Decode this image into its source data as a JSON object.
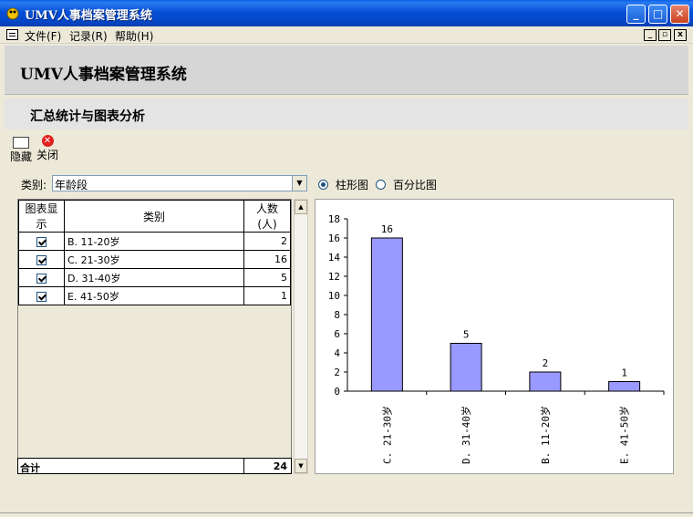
{
  "window": {
    "title": "UMV人事档案管理系统"
  },
  "menu": {
    "items": [
      "文件(F)",
      "记录(R)",
      "帮助(H)"
    ]
  },
  "header": {
    "app_title": "UMV人事档案管理系统",
    "section_title": "汇总统计与图表分析"
  },
  "toolbar": {
    "hide_label": "隐藏",
    "close_label": "关闭"
  },
  "filter": {
    "label": "类别:",
    "value": "年龄段"
  },
  "chart_mode": {
    "bar_label": "柱形图",
    "percent_label": "百分比图",
    "selected": "柱形图"
  },
  "table": {
    "columns": [
      "图表显示",
      "类别",
      "人数(人)"
    ],
    "rows": [
      {
        "checked": true,
        "category": "B. 11-20岁",
        "count": "2"
      },
      {
        "checked": true,
        "category": "C. 21-30岁",
        "count": "16"
      },
      {
        "checked": true,
        "category": "D. 31-40岁",
        "count": "5"
      },
      {
        "checked": true,
        "category": "E. 41-50岁",
        "count": "1"
      }
    ],
    "total_label": "合计",
    "total_value": "24"
  },
  "colors": {
    "bar_fill": "#9999ff",
    "title_bar": "#0550d6"
  },
  "chart_data": {
    "type": "bar",
    "categories": [
      "C. 21-30岁",
      "D. 31-40岁",
      "B. 11-20岁",
      "E. 41-50岁"
    ],
    "values": [
      16,
      5,
      2,
      1
    ],
    "ylim": [
      0,
      18
    ],
    "yticks": [
      0,
      2,
      4,
      6,
      8,
      10,
      12,
      14,
      16,
      18
    ],
    "data_labels": true,
    "grid": false,
    "title": "",
    "xlabel": "",
    "ylabel": ""
  }
}
